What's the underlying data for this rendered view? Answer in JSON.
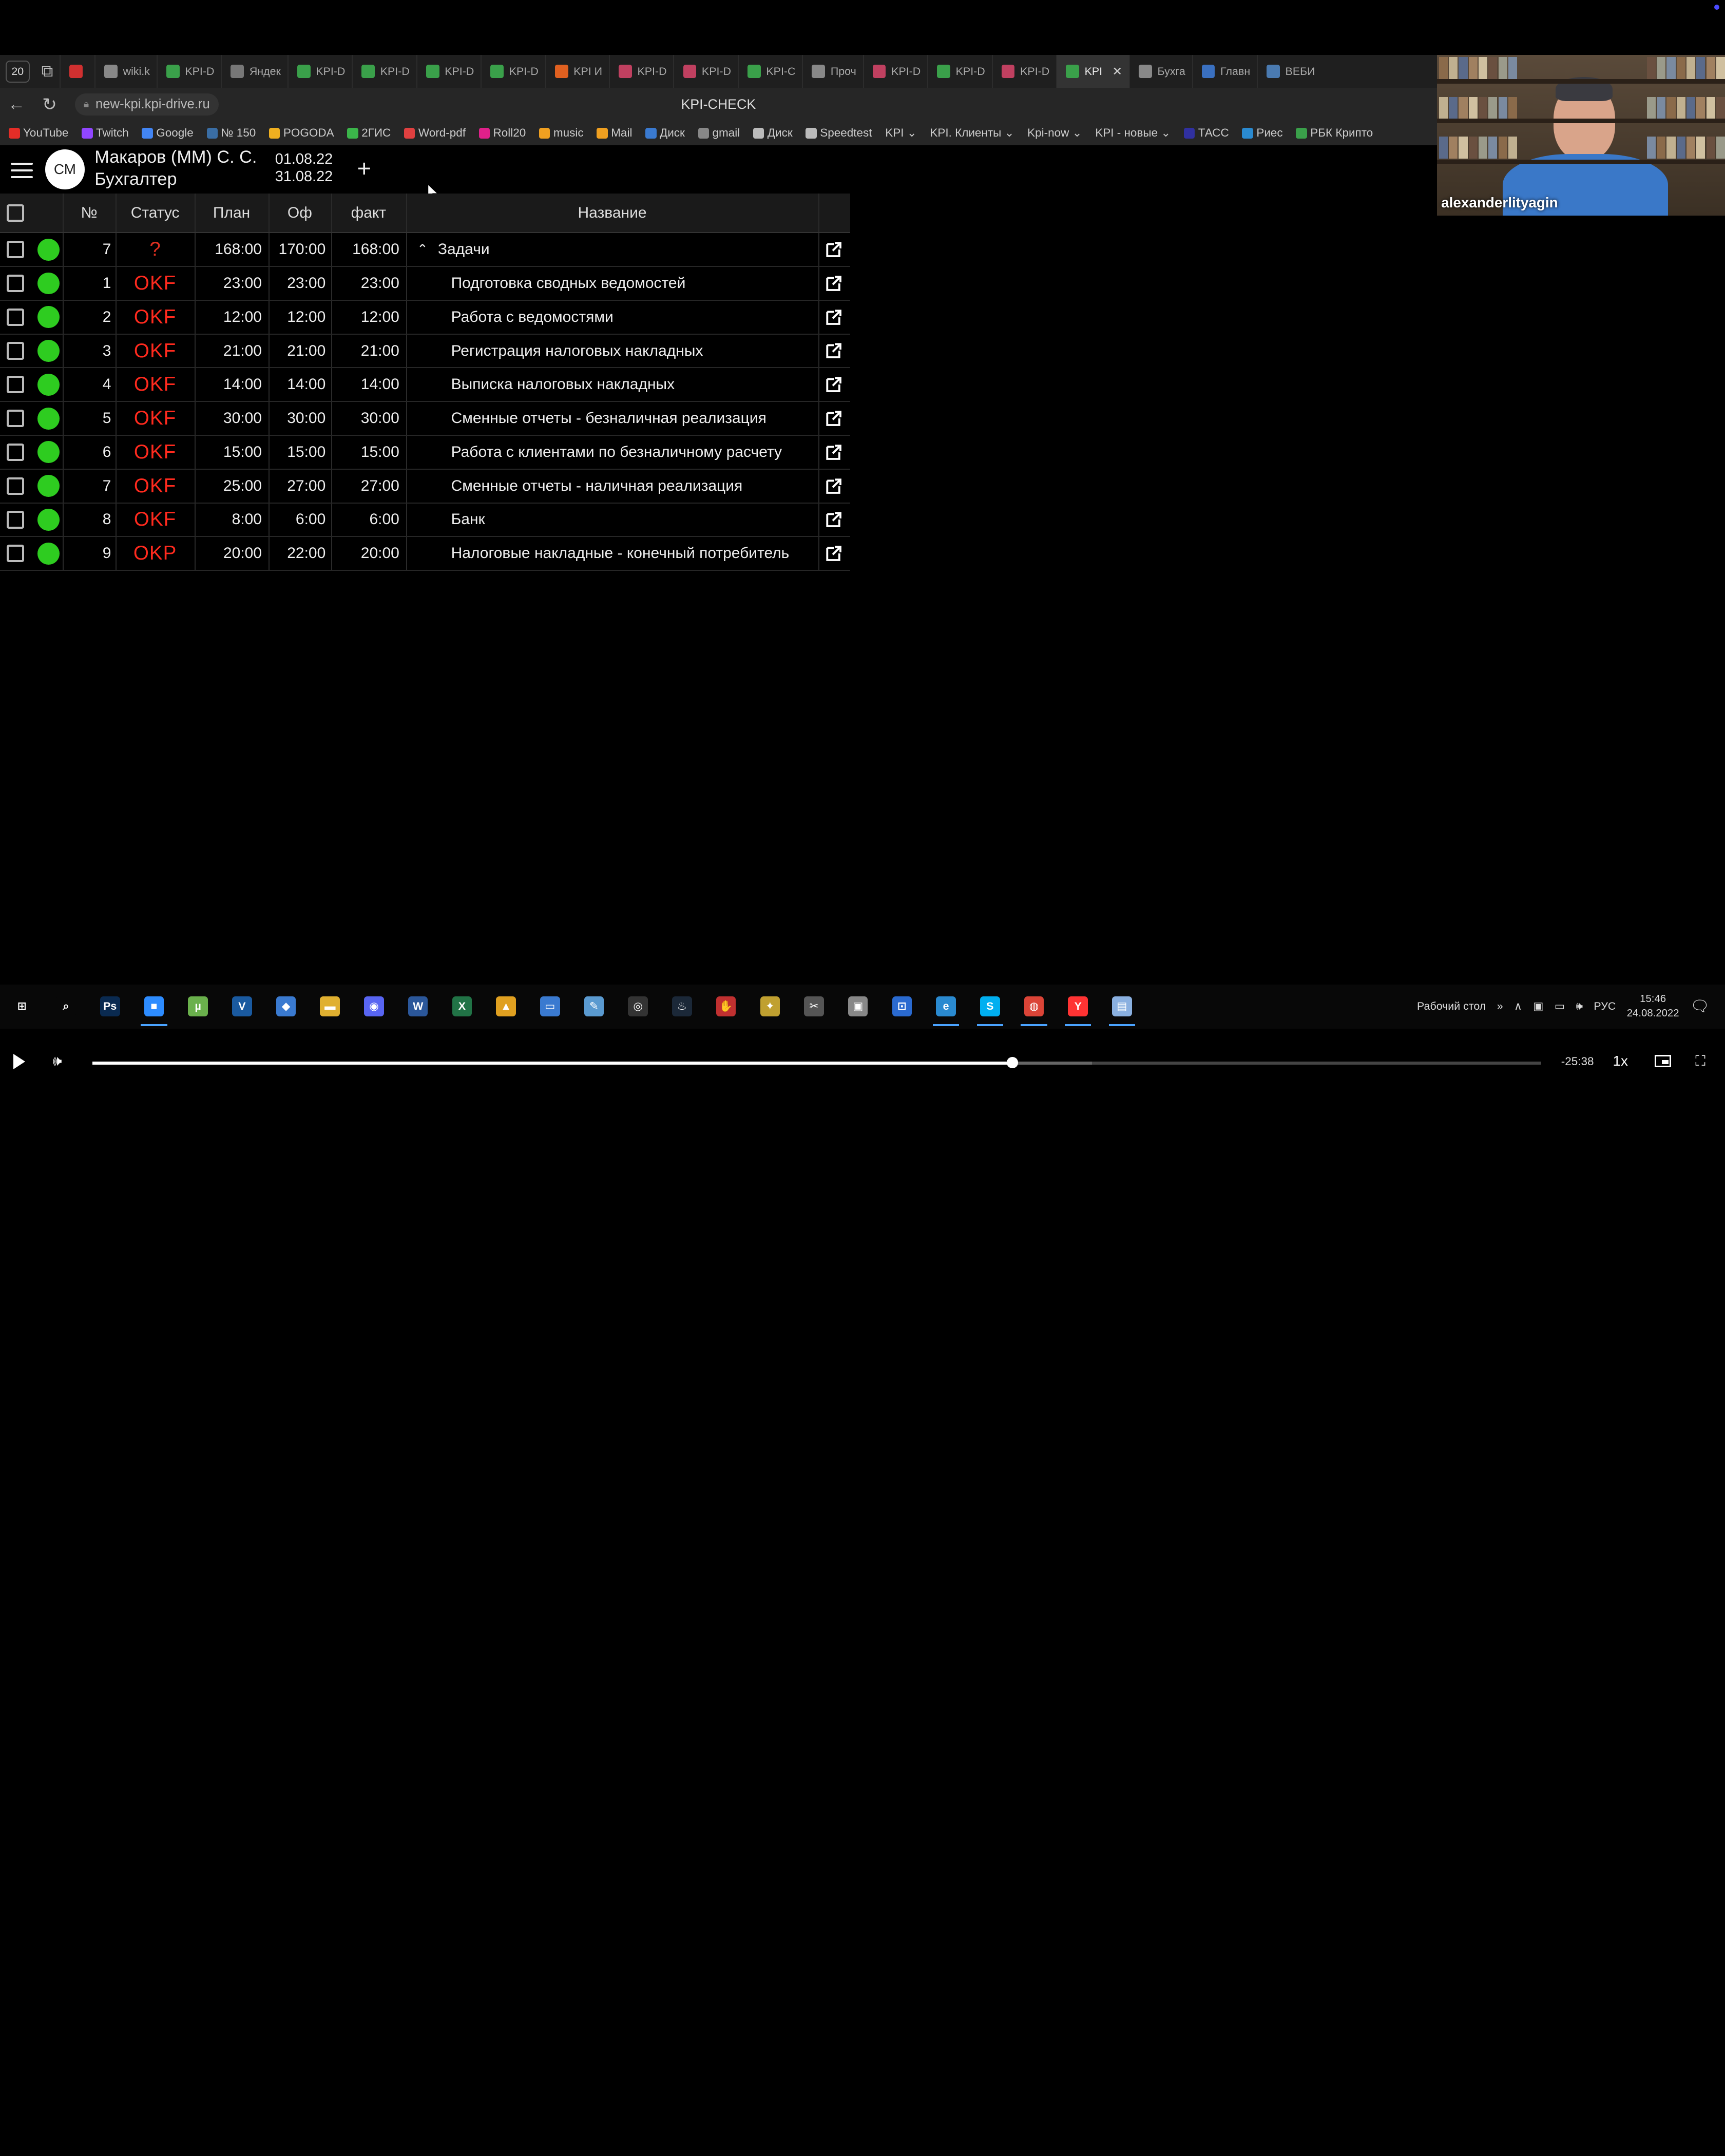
{
  "browser": {
    "tab_count": "20",
    "tabs": [
      {
        "label": "",
        "color": "#d03030"
      },
      {
        "label": "wiki.k",
        "color": "#888888"
      },
      {
        "label": "KPI-D",
        "color": "#3aa04a"
      },
      {
        "label": "Яндек",
        "color": "#777777"
      },
      {
        "label": "KPI-D",
        "color": "#3aa04a"
      },
      {
        "label": "KPI-D",
        "color": "#3aa04a"
      },
      {
        "label": "KPI-D",
        "color": "#3aa04a"
      },
      {
        "label": "KPI-D",
        "color": "#3aa04a"
      },
      {
        "label": "KPI И",
        "color": "#e06020"
      },
      {
        "label": "KPI-D",
        "color": "#c04060"
      },
      {
        "label": "KPI-D",
        "color": "#c04060"
      },
      {
        "label": "KPI-C",
        "color": "#3aa04a"
      },
      {
        "label": "Проч",
        "color": "#888888"
      },
      {
        "label": "KPI-D",
        "color": "#c04060"
      },
      {
        "label": "KPI-D",
        "color": "#3aa04a"
      },
      {
        "label": "KPI-D",
        "color": "#c04060"
      },
      {
        "label": "KPI",
        "color": "#3aa04a",
        "active": true
      },
      {
        "label": "Бухга",
        "color": "#888888"
      },
      {
        "label": "Главн",
        "color": "#3a70c0"
      },
      {
        "label": "ВЕБИ",
        "color": "#4a7ab0"
      }
    ],
    "url": "new-kpi.kpi-drive.ru",
    "page_title": "KPI-CHECK",
    "bookmarks": [
      {
        "label": "YouTube",
        "color": "#e52d27"
      },
      {
        "label": "Twitch",
        "color": "#9146ff"
      },
      {
        "label": "Google",
        "color": "#4285f4"
      },
      {
        "label": "№ 150",
        "color": "#3a6ea5"
      },
      {
        "label": "POGODA",
        "color": "#f0b020"
      },
      {
        "label": "2ГИС",
        "color": "#3bb54a"
      },
      {
        "label": "Word-pdf",
        "color": "#e04040"
      },
      {
        "label": "Roll20",
        "color": "#e0208a"
      },
      {
        "label": "music",
        "color": "#f0a020"
      },
      {
        "label": "Mail",
        "color": "#f0a020"
      },
      {
        "label": "Диск",
        "color": "#3a7ad0"
      },
      {
        "label": "gmail",
        "color": "#888888"
      },
      {
        "label": "Диск",
        "color": "#bbbbbb"
      },
      {
        "label": "Speedtest",
        "color": "#bbbbbb"
      },
      {
        "label": "KPI ⌄",
        "color": ""
      },
      {
        "label": "KPI. Клиенты ⌄",
        "color": ""
      },
      {
        "label": "Kpi-now ⌄",
        "color": ""
      },
      {
        "label": "KPI - новые ⌄",
        "color": ""
      },
      {
        "label": "ТАСС",
        "color": "#3030a0"
      },
      {
        "label": "Риес",
        "color": "#2a8ad0"
      },
      {
        "label": "РБК Крипто",
        "color": "#3aa04a"
      }
    ]
  },
  "app": {
    "avatar_initials": "СМ",
    "user_name": "Макаров (ММ) С. С.",
    "user_role": "Бухгалтер",
    "date_from": "01.08.22",
    "date_to": "31.08.22",
    "add_label": "+"
  },
  "table": {
    "headers": {
      "num": "№",
      "status": "Статус",
      "plan": "План",
      "of": "Оф",
      "fact": "факт",
      "name": "Название"
    },
    "rows": [
      {
        "num": "7",
        "status": "?",
        "plan": "168:00",
        "of": "170:00",
        "fact": "168:00",
        "name": "Задачи",
        "group": true
      },
      {
        "num": "1",
        "status": "OKF",
        "plan": "23:00",
        "of": "23:00",
        "fact": "23:00",
        "name": "Подготовка сводных ведомостей"
      },
      {
        "num": "2",
        "status": "OKF",
        "plan": "12:00",
        "of": "12:00",
        "fact": "12:00",
        "name": "Работа с ведомостями"
      },
      {
        "num": "3",
        "status": "OKF",
        "plan": "21:00",
        "of": "21:00",
        "fact": "21:00",
        "name": "Регистрация налоговых накладных"
      },
      {
        "num": "4",
        "status": "OKF",
        "plan": "14:00",
        "of": "14:00",
        "fact": "14:00",
        "name": "Выписка налоговых накладных"
      },
      {
        "num": "5",
        "status": "OKF",
        "plan": "30:00",
        "of": "30:00",
        "fact": "30:00",
        "name": "Сменные отчеты - безналичная реализация"
      },
      {
        "num": "6",
        "status": "OKF",
        "plan": "15:00",
        "of": "15:00",
        "fact": "15:00",
        "name": "Работа с клиентами по безналичному расчету"
      },
      {
        "num": "7",
        "status": "OKF",
        "plan": "25:00",
        "of": "27:00",
        "fact": "27:00",
        "name": "Сменные отчеты - наличная реализация"
      },
      {
        "num": "8",
        "status": "OKF",
        "plan": "8:00",
        "of": "6:00",
        "fact": "6:00",
        "name": "Банк"
      },
      {
        "num": "9",
        "status": "OKP",
        "plan": "20:00",
        "of": "22:00",
        "fact": "20:00",
        "name": "Налоговые накладные - конечный потребитель"
      }
    ]
  },
  "video_call": {
    "participant": "alexanderlityagin"
  },
  "taskbar": {
    "apps": [
      {
        "name": "windows-start-icon",
        "glyph": "⊞",
        "color": "#080808"
      },
      {
        "name": "search-icon",
        "glyph": "⌕",
        "color": "#080808"
      },
      {
        "name": "photoshop-icon",
        "glyph": "Ps",
        "color": "#0a2a50"
      },
      {
        "name": "zoom-icon",
        "glyph": "■",
        "color": "#2d8cff",
        "active": true
      },
      {
        "name": "utorrent-icon",
        "glyph": "µ",
        "color": "#6ab04c"
      },
      {
        "name": "visio-icon",
        "glyph": "V",
        "color": "#1a5aa0"
      },
      {
        "name": "user-icon",
        "glyph": "◆",
        "color": "#3a7ad0"
      },
      {
        "name": "folder-icon",
        "glyph": "▬",
        "color": "#e0b030"
      },
      {
        "name": "discord-icon",
        "glyph": "◉",
        "color": "#5865f2"
      },
      {
        "name": "word-icon",
        "glyph": "W",
        "color": "#2b579a"
      },
      {
        "name": "excel-icon",
        "glyph": "X",
        "color": "#217346"
      },
      {
        "name": "app-triangle-icon",
        "glyph": "▲",
        "color": "#e0a020"
      },
      {
        "name": "monitor-icon",
        "glyph": "▭",
        "color": "#3a7ad0"
      },
      {
        "name": "paint-icon",
        "glyph": "✎",
        "color": "#5a9ad0"
      },
      {
        "name": "obs-icon",
        "glyph": "◎",
        "color": "#333333"
      },
      {
        "name": "steam-icon",
        "glyph": "♨",
        "color": "#1b2838"
      },
      {
        "name": "hand-icon",
        "glyph": "✋",
        "color": "#c03030"
      },
      {
        "name": "magic-wand-icon",
        "glyph": "✦",
        "color": "#c0a030"
      },
      {
        "name": "snipping-icon",
        "glyph": "✂",
        "color": "#555555"
      },
      {
        "name": "folder-gray-icon",
        "glyph": "▣",
        "color": "#888888"
      },
      {
        "name": "crop-icon",
        "glyph": "⊡",
        "color": "#2a6ad0"
      },
      {
        "name": "edge-icon",
        "glyph": "e",
        "color": "#2a8ad0",
        "active": true
      },
      {
        "name": "skype-icon",
        "glyph": "S",
        "color": "#00aff0",
        "active": true
      },
      {
        "name": "chrome-icon",
        "glyph": "◍",
        "color": "#db4437",
        "active": true
      },
      {
        "name": "yandex-browser-icon",
        "glyph": "Y",
        "color": "#ff3333",
        "active": true
      },
      {
        "name": "notepad-icon",
        "glyph": "▤",
        "color": "#8ab0e0",
        "active": true
      }
    ],
    "desktop_label": "Рабочий стол",
    "tray_chevrons": "»",
    "language": "РУС",
    "time": "15:46",
    "date": "24.08.2022"
  },
  "player": {
    "progress": 0.635,
    "buffered": 0.69,
    "time_remaining": "-25:38",
    "speed": "1x"
  }
}
